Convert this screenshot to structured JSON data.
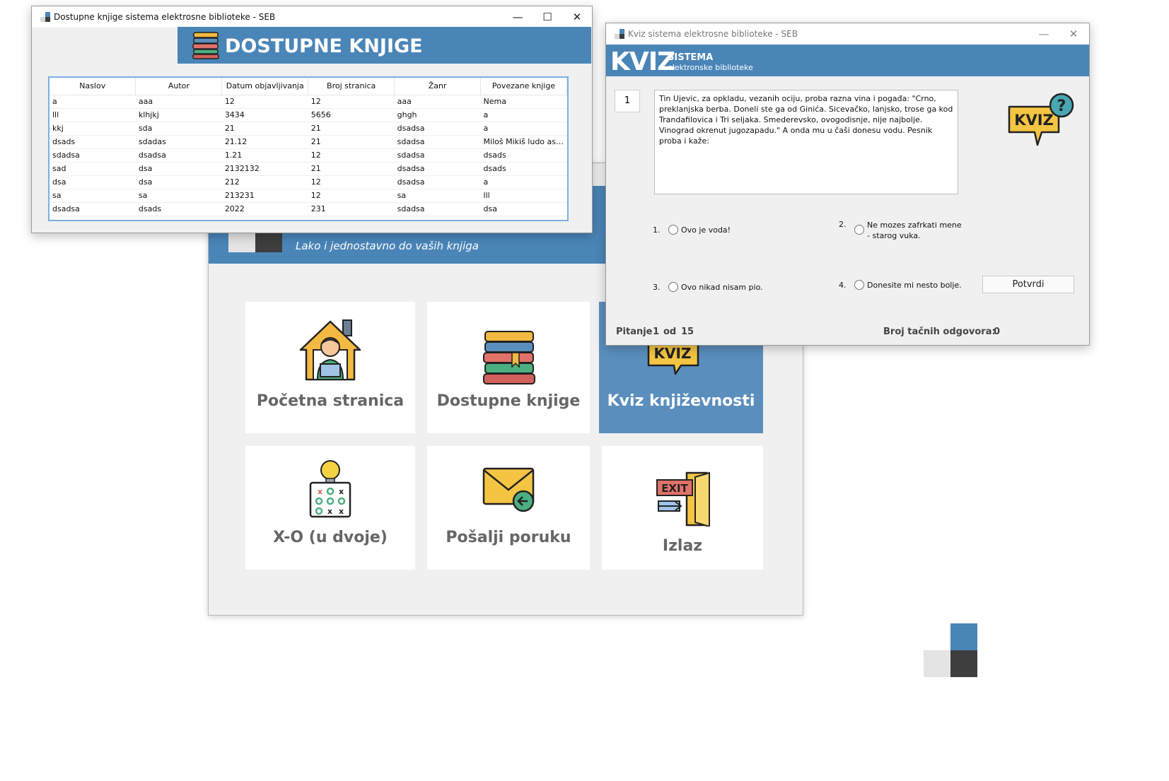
{
  "main_window": {
    "subtitle": "Lako i jednostavno do vaših knjiga",
    "tiles": [
      {
        "label": "Početna stranica",
        "icon": "home-user-icon"
      },
      {
        "label": "Dostupne knjige",
        "icon": "books-icon"
      },
      {
        "label": "Kviz književnosti",
        "icon": "kviz-icon",
        "active": true
      },
      {
        "label": "X-O (u dvoje)",
        "icon": "tic-tac-toe-icon"
      },
      {
        "label": "Pošalji poruku",
        "icon": "envelope-icon"
      },
      {
        "label": "Izlaz",
        "icon": "exit-icon"
      }
    ]
  },
  "books_window": {
    "title": "Dostupne knjige sistema elektrosne biblioteke - SEB",
    "header": "DOSTUPNE KNJIGE",
    "columns": [
      "Naslov",
      "Autor",
      "Datum objavljivanja",
      "Broj stranica",
      "Žanr",
      "Povezane knjige"
    ],
    "rows": [
      [
        "a",
        "aaa",
        "12",
        "12",
        "aaa",
        "Nema"
      ],
      [
        "lll",
        "klhjkj",
        "3434",
        "5656",
        "ghgh",
        "a"
      ],
      [
        "kkj",
        "sda",
        "21",
        "21",
        "dsadsa",
        "a"
      ],
      [
        "dsads",
        "sdadas",
        "21.12",
        "21",
        "sdadsa",
        "Miloš Mikiš ludo ass ..."
      ],
      [
        "sdadsa",
        "dsadsa",
        "1.21",
        "12",
        "sdadsa",
        "dsads"
      ],
      [
        "sad",
        "dsa",
        "2132132",
        "21",
        "dsadsa",
        "dsads"
      ],
      [
        "dsa",
        "dsa",
        "212",
        "12",
        "dsadsa",
        "a"
      ],
      [
        "sa",
        "sa",
        "213231",
        "12",
        "sa",
        "lll"
      ],
      [
        "dsadsa",
        "dsads",
        "2022",
        "231",
        "sdadsa",
        "dsa"
      ]
    ]
  },
  "quiz_window": {
    "title": "Kviz sistema elektrosne biblioteke - SEB",
    "header_big": "KVIZ",
    "header_sistema": "SISTEMA",
    "header_sub": "elektronske biblioteke",
    "question_number": "1",
    "question_text": "Tin Ujevic, za opkladu, vezanih ociju, proba razna vina i pogađa: \"Crno, preklanjska berba. Doneli ste ga od Ginića. Sicevačko, lanjsko, trose ga kod Trandafilovica i Tri seljaka. Smederevsko, ovogodisnje, nije najbolje. Vinograd okrenut jugozapadu.\" A onda mu u čaši donesu vodu. Pesnik proba i kaže:",
    "answers": [
      {
        "num": "1.",
        "text": "Ovo je voda!"
      },
      {
        "num": "2.",
        "text": "Ne mozes zafrkati mene - starog vuka."
      },
      {
        "num": "3.",
        "text": "Ovo nikad nisam pio."
      },
      {
        "num": "4.",
        "text": "Donesite mi nesto bolje."
      }
    ],
    "confirm_label": "Potvrdi",
    "pitanje_label": "Pitanje",
    "pitanje_current": "1",
    "od_label": "od",
    "pitanje_total": "15",
    "correct_label": "Broj tačnih odgovora:",
    "correct_count": "0",
    "icon_text": "KVIZ"
  },
  "window_controls": {
    "minimize": "—",
    "maximize": "☐",
    "close": "✕"
  },
  "colors": {
    "accent_blue": "#4a85b8",
    "tile_active": "#5a8ebd",
    "light_gray": "#e4e4e4",
    "dark_gray": "#3e3e3e"
  }
}
